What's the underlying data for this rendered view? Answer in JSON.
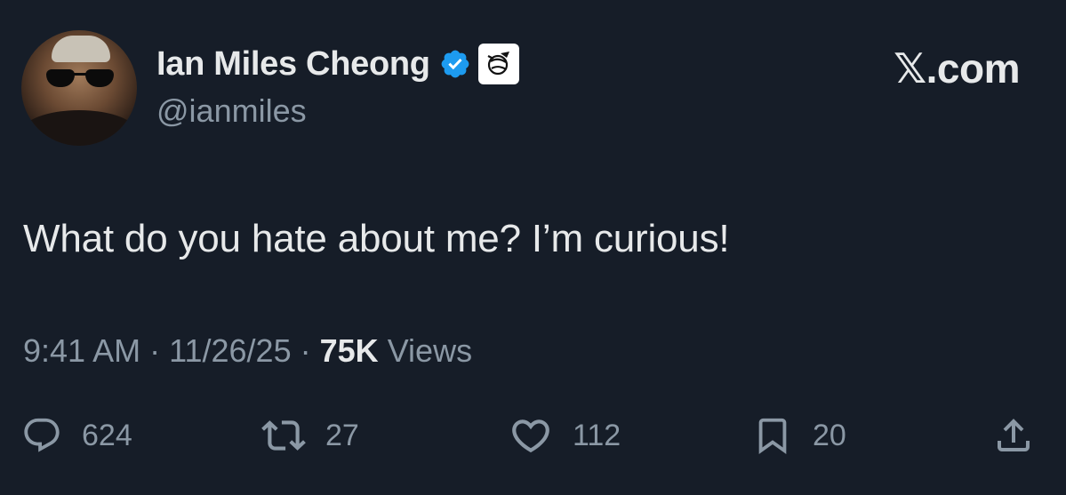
{
  "author": {
    "display_name": "Ian Miles Cheong",
    "handle": "@ianmiles",
    "avatar_icon": "profile-photo",
    "verified_icon": "verified-badge-icon",
    "affiliate_icon": "affiliate-badge-icon"
  },
  "brand": {
    "logo_text": "𝕏.com"
  },
  "post": {
    "text": "What do you hate about me? I’m curious!",
    "time": "9:41 AM",
    "separator": "·",
    "date": "11/26/25",
    "views_count": "75K",
    "views_label": "Views"
  },
  "actions": {
    "replies": "624",
    "reposts": "27",
    "likes": "112",
    "bookmarks": "20"
  },
  "colors": {
    "background": "#161d28",
    "text_primary": "#e7e9ea",
    "text_secondary": "#8b98a5",
    "verified_blue": "#1d9bf0"
  }
}
